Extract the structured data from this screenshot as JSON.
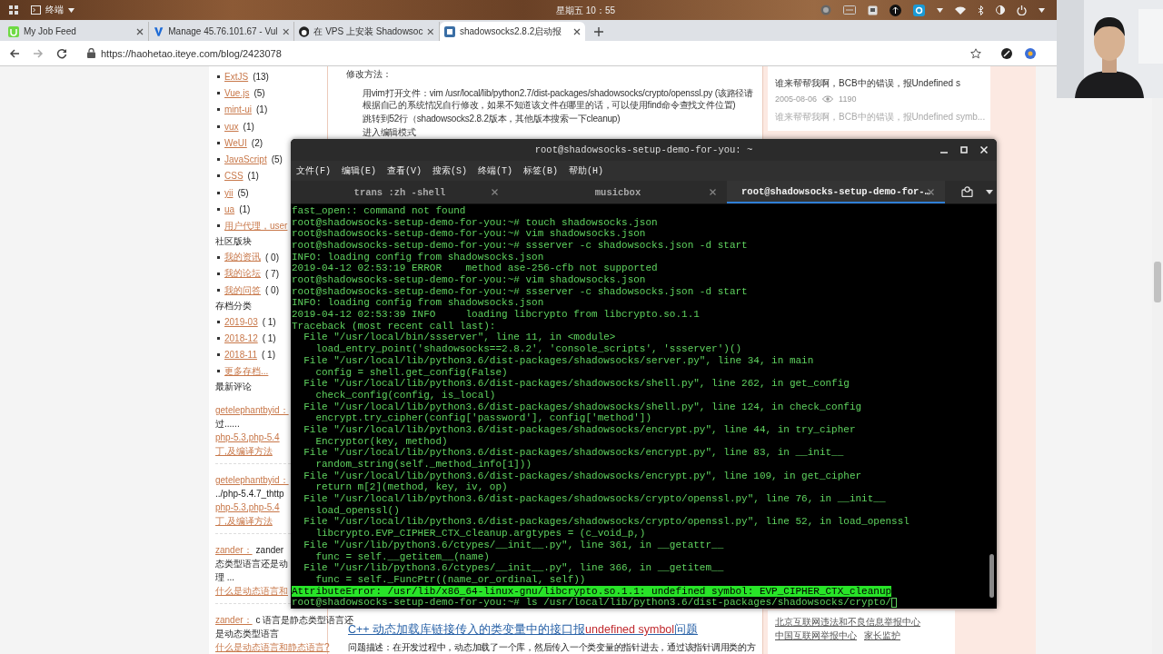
{
  "top_panel": {
    "app": "终端",
    "clock": "星期五 10：55"
  },
  "browser": {
    "tabs": [
      {
        "title": "My Job Feed",
        "selected": false
      },
      {
        "title": "Manage 45.76.101.67 - Vul",
        "selected": false
      },
      {
        "title": "在 VPS 上安装 Shadowsoc",
        "selected": false
      },
      {
        "title": "shadowsocks2.8.2启动报",
        "selected": true
      }
    ],
    "url": "https://haohetao.iteye.com/blog/2423078"
  },
  "sidebar": {
    "items": [
      {
        "kind": "link",
        "label": "ExtJS",
        "count": "(13)"
      },
      {
        "kind": "link",
        "label": "Vue.js",
        "count": "(5)"
      },
      {
        "kind": "link",
        "label": "mint-ui",
        "count": "(1)"
      },
      {
        "kind": "link",
        "label": "vux",
        "count": "(1)"
      },
      {
        "kind": "link",
        "label": "WeUI",
        "count": "(2)"
      },
      {
        "kind": "link",
        "label": "JavaScript",
        "count": "(5)"
      },
      {
        "kind": "link",
        "label": "CSS",
        "count": "(1)"
      },
      {
        "kind": "link",
        "label": "yii",
        "count": "(5)"
      },
      {
        "kind": "link",
        "label": "ua",
        "count": "(1)"
      },
      {
        "kind": "link",
        "label": "用户代理，user"
      },
      {
        "kind": "heading",
        "text": "社区版块"
      },
      {
        "kind": "link",
        "label": "我的资讯",
        "count": "( 0)"
      },
      {
        "kind": "link",
        "label": "我的论坛",
        "count": "( 7)"
      },
      {
        "kind": "link",
        "label": "我的问答",
        "count": "( 0)"
      },
      {
        "kind": "heading",
        "text": "存档分类"
      },
      {
        "kind": "link",
        "label": "2019-03",
        "count": "( 1)"
      },
      {
        "kind": "link",
        "label": "2018-12",
        "count": "( 1)"
      },
      {
        "kind": "link",
        "label": "2018-11",
        "count": "( 1)"
      },
      {
        "kind": "link",
        "label": "更多存档..."
      },
      {
        "kind": "heading",
        "text": "最新评论"
      },
      {
        "kind": "comment",
        "author": "getelephantbyid：",
        "lines": [
          "过......"
        ],
        "links": [
          "php-5.3,php-5.4",
          "丁,及编译方法"
        ]
      },
      {
        "kind": "comment",
        "author": "getelephantbyid：",
        "lines": [
          "../php-5.4.7_thttp"
        ],
        "links": [
          "php-5.3,php-5.4",
          "丁,及编译方法"
        ]
      },
      {
        "kind": "comment",
        "author": "zander：",
        "first": "zander",
        "lines": [
          "态类型语言还是动",
          "理 ..."
        ],
        "links": [
          "什么是动态语言和"
        ]
      },
      {
        "kind": "comment",
        "author": "zander：",
        "first": "c 语言是静态类型语言还",
        "lines": [
          "是动态类型语言"
        ],
        "links": [
          "什么是动态语言和静态语言?"
        ]
      }
    ]
  },
  "article": {
    "heading": "修改方法：",
    "steps": [
      "用vim打开文件：vim /usr/local/lib/python2.7/dist-packages/shadowsocks/crypto/openssl.py (该路径请根据自己的系统情况自行修改，如果不知道该文件在哪里的话，可以使用find命令查找文件位置)",
      "跳转到52行（shadowsocks2.8.2版本，其他版本搜索一下cleanup)",
      "进入编辑模式"
    ],
    "related": {
      "title_before": "C++ 动态加载库链接传入的类变量中的接口报",
      "title_highlight": "undefined symbol",
      "title_after": "问题",
      "summary": "问题描述：在开发过程中，动态加载了一个库，然后传入一个类变量的指针进去，通过该指针调用类的方"
    }
  },
  "right_panel": {
    "card": {
      "title": "谁来帮帮我啊，BCB中的错误，报Undefined s",
      "date": "2005-08-06",
      "views": "1190",
      "excerpt": "谁来帮帮我啊，BCB中的错误，报Undefined symb..."
    },
    "footer_links": [
      "北京互联网违法和不良信息举报中心",
      "中国互联网举报中心",
      "家长监护"
    ]
  },
  "terminal": {
    "title": "root@shadowsocks-setup-demo-for-you: ~",
    "menu": [
      "文件(F)",
      "编辑(E)",
      "查看(V)",
      "搜索(S)",
      "终端(T)",
      "标签(B)",
      "帮助(H)"
    ],
    "tabs": [
      {
        "label": "trans :zh -shell",
        "selected": false
      },
      {
        "label": "musicbox",
        "selected": false
      },
      {
        "label": "root@shadowsocks-setup-demo-for-…",
        "selected": true
      }
    ],
    "lines": [
      {
        "kind": "text",
        "text": "fast_open:: command not found"
      },
      {
        "kind": "text",
        "text": "root@shadowsocks-setup-demo-for-you:~# touch shadowsocks.json"
      },
      {
        "kind": "text",
        "text": "root@shadowsocks-setup-demo-for-you:~# vim shadowsocks.json"
      },
      {
        "kind": "text",
        "text": "root@shadowsocks-setup-demo-for-you:~# ssserver -c shadowsocks.json -d start"
      },
      {
        "kind": "text",
        "text": "INFO: loading config from shadowsocks.json"
      },
      {
        "kind": "text",
        "text": "2019-04-12 02:53:19 ERROR    method ase-256-cfb not supported"
      },
      {
        "kind": "text",
        "text": "root@shadowsocks-setup-demo-for-you:~# vim shadowsocks.json"
      },
      {
        "kind": "text",
        "text": "root@shadowsocks-setup-demo-for-you:~# ssserver -c shadowsocks.json -d start"
      },
      {
        "kind": "text",
        "text": "INFO: loading config from shadowsocks.json"
      },
      {
        "kind": "text",
        "text": "2019-04-12 02:53:39 INFO     loading libcrypto from libcrypto.so.1.1"
      },
      {
        "kind": "text",
        "text": "Traceback (most recent call last):"
      },
      {
        "kind": "text",
        "text": "  File \"/usr/local/bin/ssserver\", line 11, in <module>"
      },
      {
        "kind": "text",
        "text": "    load_entry_point('shadowsocks==2.8.2', 'console_scripts', 'ssserver')()"
      },
      {
        "kind": "text",
        "text": "  File \"/usr/local/lib/python3.6/dist-packages/shadowsocks/server.py\", line 34, in main"
      },
      {
        "kind": "text",
        "text": "    config = shell.get_config(False)"
      },
      {
        "kind": "text",
        "text": "  File \"/usr/local/lib/python3.6/dist-packages/shadowsocks/shell.py\", line 262, in get_config"
      },
      {
        "kind": "text",
        "text": "    check_config(config, is_local)"
      },
      {
        "kind": "text",
        "text": "  File \"/usr/local/lib/python3.6/dist-packages/shadowsocks/shell.py\", line 124, in check_config"
      },
      {
        "kind": "text",
        "text": "    encrypt.try_cipher(config['password'], config['method'])"
      },
      {
        "kind": "text",
        "text": "  File \"/usr/local/lib/python3.6/dist-packages/shadowsocks/encrypt.py\", line 44, in try_cipher"
      },
      {
        "kind": "text",
        "text": "    Encryptor(key, method)"
      },
      {
        "kind": "text",
        "text": "  File \"/usr/local/lib/python3.6/dist-packages/shadowsocks/encrypt.py\", line 83, in __init__"
      },
      {
        "kind": "text",
        "text": "    random_string(self._method_info[1]))"
      },
      {
        "kind": "text",
        "text": "  File \"/usr/local/lib/python3.6/dist-packages/shadowsocks/encrypt.py\", line 109, in get_cipher"
      },
      {
        "kind": "text",
        "text": "    return m[2](method, key, iv, op)"
      },
      {
        "kind": "text",
        "text": "  File \"/usr/local/lib/python3.6/dist-packages/shadowsocks/crypto/openssl.py\", line 76, in __init__"
      },
      {
        "kind": "text",
        "text": "    load_openssl()"
      },
      {
        "kind": "text",
        "text": "  File \"/usr/local/lib/python3.6/dist-packages/shadowsocks/crypto/openssl.py\", line 52, in load_openssl"
      },
      {
        "kind": "text",
        "text": "    libcrypto.EVP_CIPHER_CTX_cleanup.argtypes = (c_void_p,)"
      },
      {
        "kind": "text",
        "text": "  File \"/usr/lib/python3.6/ctypes/__init__.py\", line 361, in __getattr__"
      },
      {
        "kind": "text",
        "text": "    func = self.__getitem__(name)"
      },
      {
        "kind": "text",
        "text": "  File \"/usr/lib/python3.6/ctypes/__init__.py\", line 366, in __getitem__"
      },
      {
        "kind": "text",
        "text": "    func = self._FuncPtr((name_or_ordinal, self))"
      },
      {
        "kind": "highlight",
        "text": "AttributeError: /usr/lib/x86_64-linux-gnu/libcrypto.so.1.1: undefined symbol: EVP_CIPHER_CTX_cleanup"
      },
      {
        "kind": "input",
        "text": "root@shadowsocks-setup-demo-for-you:~# ls /usr/local/lib/python3.6/dist-packages/shadowsocks/crypto/"
      }
    ]
  }
}
